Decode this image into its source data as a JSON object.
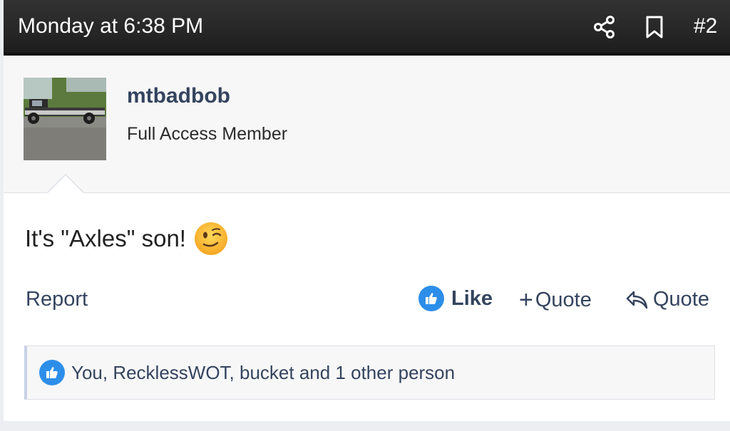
{
  "header": {
    "timestamp": "Monday at 6:38 PM",
    "post_number": "#2",
    "share_icon": "share-icon",
    "bookmark_icon": "bookmark-icon",
    "background_color": "#262626"
  },
  "post": {
    "author": {
      "username": "mtbadbob",
      "title": "Full Access Member",
      "avatar": "truck-photo-avatar"
    },
    "message": "It's \"Axles\" son!",
    "emoji": "winking-face-emoji"
  },
  "actions": {
    "report": "Report",
    "like": "Like",
    "multi_quote": "Quote",
    "reply_quote": "Quote"
  },
  "reactions": {
    "text": "You, RecklessWOT, bucket and 1 other person",
    "icon": "thumbs-up-icon",
    "accent_color": "#2d8eea"
  }
}
